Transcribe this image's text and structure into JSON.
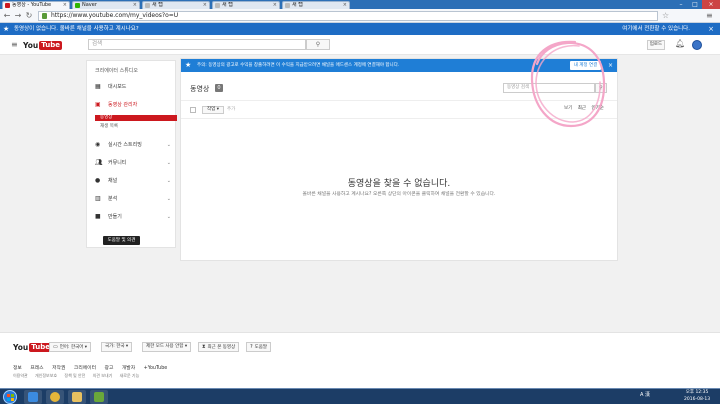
{
  "browser": {
    "tabs": [
      {
        "label": "동영상 - YouTube",
        "favicon_color": "#cc181e"
      },
      {
        "label": "Naver",
        "favicon_color": "#2db400"
      },
      {
        "label": "새 탭",
        "favicon_color": "#bbbbbb"
      },
      {
        "label": "새 탭",
        "favicon_color": "#bbbbbb"
      },
      {
        "label": "새 탭",
        "favicon_color": "#bbbbbb"
      }
    ],
    "url": "https://www.youtube.com/my_videos?o=U",
    "nav": {
      "back": "←",
      "forward": "→",
      "reload": "↻"
    }
  },
  "notice": {
    "message": "동영상이 없습니다. 올바른 채널을 사용하고 계시나요?",
    "switch_label": "여기에서 전환할 수 있습니다.",
    "close": "×"
  },
  "header": {
    "logo_you": "You",
    "logo_tube": "Tube",
    "search_placeholder": "검색",
    "upload_label": "업로드"
  },
  "sidebar": {
    "title": "크리에이터 스튜디오",
    "items": [
      {
        "label": "대시보드",
        "icon": "dashboard-icon",
        "chev": ""
      },
      {
        "label": "동영상 관리자",
        "icon": "video-manager-icon",
        "chev": ""
      },
      {
        "label": "실시간 스트리밍",
        "icon": "live-icon",
        "chev": "⌄"
      },
      {
        "label": "커뮤니티",
        "icon": "community-icon",
        "chev": "⌄"
      },
      {
        "label": "채널",
        "icon": "channel-icon",
        "chev": "⌄"
      },
      {
        "label": "분석",
        "icon": "analytics-icon",
        "chev": "⌄"
      },
      {
        "label": "만들기",
        "icon": "create-icon",
        "chev": "⌄"
      }
    ],
    "active_sub": "동영상",
    "sub2": "재생 목록",
    "feedback": "도움말 및 의견"
  },
  "main": {
    "alert": "주의: 동영상의 광고로 수익을 창출하려면 이 수익을 지급받으려면 채널을 애드센스 계정에 연결해야 합니다.",
    "alert_button": "내 계정 연결",
    "alert_close": "×",
    "title": "동영상",
    "count": "0",
    "search_placeholder": "동영상 검색",
    "actions_label": "작업 ▾",
    "add_label": "추가",
    "sort_label": "보기",
    "sort_options": [
      "최근",
      "인기순"
    ],
    "empty_heading": "동영상을 찾을 수 없습니다.",
    "empty_text": "올바른 채널을 사용하고 계시나요? 오른쪽 상단의 아이콘을 클릭하여 채널을 전환할 수 있습니다."
  },
  "footer": {
    "logo_you": "You",
    "logo_tube": "Tube",
    "buttons": [
      "언어: 한국어 ▾",
      "국가: 한국 ▾",
      "제한 모드 사용 안함 ▾",
      "최근 본 동영상",
      "도움말"
    ],
    "links": [
      "정보",
      "프레스",
      "저작권",
      "크리에이터",
      "광고",
      "개발자",
      "+YouTube"
    ],
    "links2": [
      "이용약관",
      "개인정보보호",
      "정책 및 안전",
      "의견 보내기",
      "새로운 기능"
    ]
  },
  "taskbar": {
    "tray_lang": "A 漢",
    "time": "오후 12:35",
    "date": "2016-08-13"
  },
  "colors": {
    "brand_red": "#cc181e",
    "notice_blue": "#1e6cc4",
    "alert_blue": "#1f7ed6",
    "annotation_pink": "#f4a6c8"
  }
}
